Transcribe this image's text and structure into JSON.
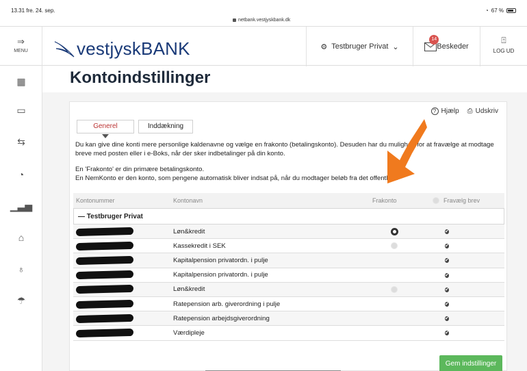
{
  "status_bar": {
    "time": "13.31  fre. 24. sep.",
    "url": "netbank.vestjyskbank.dk",
    "battery": "67 %"
  },
  "header": {
    "menu_label": "MENU",
    "logo_text": "vestjyskBANK",
    "user_label": "Testbruger Privat",
    "messages_label": "Beskeder",
    "messages_count": "14",
    "logout_label": "LOG UD"
  },
  "page": {
    "title": "Kontoindstillinger"
  },
  "actions": {
    "help": "Hjælp",
    "print": "Udskriv"
  },
  "tabs": [
    {
      "label": "Generel",
      "active": true
    },
    {
      "label": "Inddækning",
      "active": false
    }
  ],
  "description": [
    "Du kan give dine konti mere personlige kaldenavne og vælge en frakonto (betalingskonto). Desuden har du mulighed for at fravælge at modtage breve med posten eller i e-Boks, når der sker indbetalinger på din konto.",
    "En 'Frakonto' er din primære betalingskonto.",
    "En NemKonto er den konto, som pengene automatisk bliver indsat på, når du modtager beløb fra det offentlige."
  ],
  "table": {
    "headers": {
      "account_number": "Kontonummer",
      "account_name": "Kontonavn",
      "from_account": "Frakonto",
      "opt_out": "Fravælg brev"
    },
    "group_label": "— Testbruger Privat",
    "rows": [
      {
        "name": "Løn&kredit",
        "frakonto": "selected",
        "brev": true
      },
      {
        "name": "Kassekredit i SEK",
        "frakonto": "available",
        "brev": true
      },
      {
        "name": "Kapitalpension privatordn. i pulje",
        "frakonto": "none",
        "brev": true
      },
      {
        "name": "Kapitalpension privatordn. i pulje",
        "frakonto": "none",
        "brev": true
      },
      {
        "name": "Løn&kredit",
        "frakonto": "available",
        "brev": true
      },
      {
        "name": "Ratepension arb. giverordning i pulje",
        "frakonto": "none",
        "brev": true
      },
      {
        "name": "Ratepension arbejdsgiverordning",
        "frakonto": "none",
        "brev": true
      },
      {
        "name": "Værdipleje",
        "frakonto": "none",
        "brev": true
      }
    ]
  },
  "save_button": "Gem indstillinger",
  "colors": {
    "brand_blue": "#1a3a78",
    "save_green": "#5cb85c",
    "arrow_orange": "#f07a1e",
    "badge_red": "#d9534f"
  }
}
